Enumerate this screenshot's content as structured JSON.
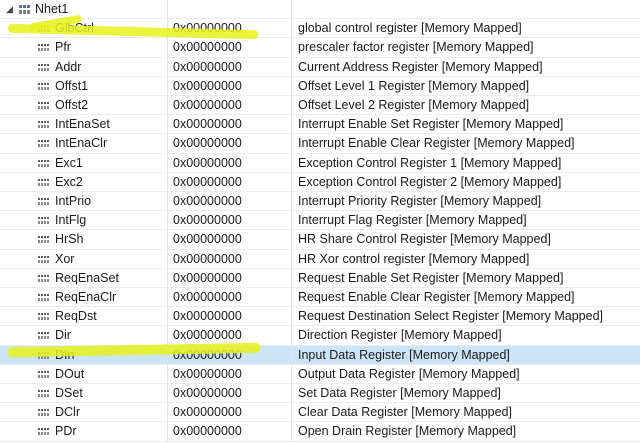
{
  "root": {
    "label": "Nhet1",
    "expanded_icon": "chevron-down-icon",
    "icon": "peripheral-icon"
  },
  "registers": [
    {
      "name": "GlbCtrl",
      "value": "0x00000000",
      "description": "global control register [Memory Mapped]"
    },
    {
      "name": "Pfr",
      "value": "0x00000000",
      "description": "prescaler factor register [Memory Mapped]"
    },
    {
      "name": "Addr",
      "value": "0x00000000",
      "description": "Current Address Register [Memory Mapped]"
    },
    {
      "name": "Offst1",
      "value": "0x00000000",
      "description": "Offset Level 1 Register [Memory Mapped]"
    },
    {
      "name": "Offst2",
      "value": "0x00000000",
      "description": "Offset Level 2 Register [Memory Mapped]"
    },
    {
      "name": "IntEnaSet",
      "value": "0x00000000",
      "description": "Interrupt Enable Set Register [Memory Mapped]"
    },
    {
      "name": "IntEnaClr",
      "value": "0x00000000",
      "description": "Interrupt Enable Clear Register [Memory Mapped]"
    },
    {
      "name": "Exc1",
      "value": "0x00000000",
      "description": "Exception Control Register 1 [Memory Mapped]"
    },
    {
      "name": "Exc2",
      "value": "0x00000000",
      "description": "Exception Control Register 2 [Memory Mapped]"
    },
    {
      "name": "IntPrio",
      "value": "0x00000000",
      "description": "Interrupt Priority Register [Memory Mapped]"
    },
    {
      "name": "IntFlg",
      "value": "0x00000000",
      "description": "Interrupt Flag Register [Memory Mapped]"
    },
    {
      "name": "HrSh",
      "value": "0x00000000",
      "description": "HR Share Control Register [Memory Mapped]"
    },
    {
      "name": "Xor",
      "value": "0x00000000",
      "description": "HR Xor control register [Memory Mapped]"
    },
    {
      "name": "ReqEnaSet",
      "value": "0x00000000",
      "description": "Request Enable Set Register [Memory Mapped]"
    },
    {
      "name": "ReqEnaClr",
      "value": "0x00000000",
      "description": "Request Enable Clear Register [Memory Mapped]"
    },
    {
      "name": "ReqDst",
      "value": "0x00000000",
      "description": "Request Destination Select Register [Memory Mapped]"
    },
    {
      "name": "Dir",
      "value": "0x00000000",
      "description": "Direction Register [Memory Mapped]"
    },
    {
      "name": "DIn",
      "value": "0x00000000",
      "description": "Input Data Register [Memory Mapped]",
      "selected": true
    },
    {
      "name": "DOut",
      "value": "0x00000000",
      "description": "Output Data Register [Memory Mapped]"
    },
    {
      "name": "DSet",
      "value": "0x00000000",
      "description": "Set Data Register [Memory Mapped]"
    },
    {
      "name": "DClr",
      "value": "0x00000000",
      "description": "Clear Data Register [Memory Mapped]"
    },
    {
      "name": "PDr",
      "value": "0x00000000",
      "description": "Open Drain Register [Memory Mapped]"
    }
  ],
  "register_icon": "register-icon",
  "colors": {
    "selected_row": "#cce4f7",
    "highlighter": "#e6f21a"
  }
}
